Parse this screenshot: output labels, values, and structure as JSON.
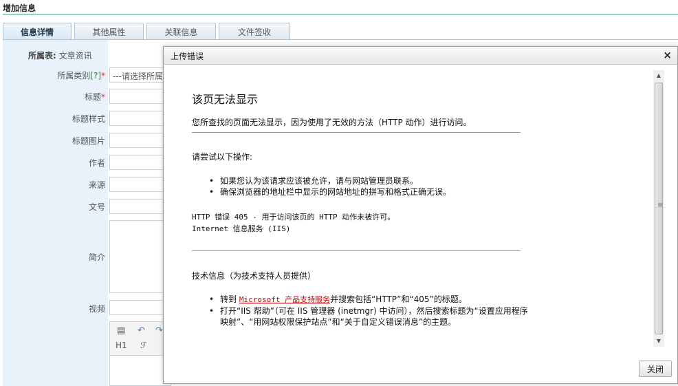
{
  "page": {
    "title": "增加信息"
  },
  "tabs": [
    {
      "label": "信息详情",
      "active": true
    },
    {
      "label": "其他属性",
      "active": false
    },
    {
      "label": "关联信息",
      "active": false
    },
    {
      "label": "文件签收",
      "active": false
    }
  ],
  "form": {
    "owner_label": "所属表:",
    "owner_value": "文章资讯",
    "category_label": "所属类别",
    "category_hint": "[?]",
    "required_mark": "*",
    "category_placeholder": "---请选择所属",
    "fields": {
      "title": "标题",
      "title_style": "标题样式",
      "title_image": "标题图片",
      "author": "作者",
      "source": "来源",
      "doc_no": "文号",
      "summary": "简介",
      "video": "视频"
    },
    "editor_heading_btn": "H1",
    "editor_font_btn": "ℱ"
  },
  "dialog": {
    "title": "上传错误",
    "close_icon": "×",
    "error_title": "该页无法显示",
    "error_desc": "您所查找的页面无法显示，因为使用了无效的方法（HTTP 动作）进行访问。",
    "try_label": "请尝试以下操作:",
    "try_items": [
      "如果您认为该请求应该被允许，请与网站管理员联系。",
      "确保浏览器的地址栏中显示的网站地址的拼写和格式正确无误。"
    ],
    "error_code_line": "HTTP 错误 405 - 用于访问该页的 HTTP 动作未被许可。",
    "server_line": "Internet 信息服务 (IIS)",
    "tech_label": "技术信息（为技术支持人员提供）",
    "tech_item1_prefix": "转到",
    "tech_item1_link": "Microsoft 产品支持服务",
    "tech_item1_suffix": "并搜索包括“HTTP”和“405”的标题。",
    "tech_item2": "打开“IIS 帮助”（可在 IIS 管理器 (inetmgr) 中访问），然后搜索标题为“设置应用程序映射”、“用网站权限保护站点”和“关于自定义错误消息”的主题。",
    "close_button": "关闭"
  },
  "colors": {
    "accent_rule": "#8fd3c6",
    "link": "#cc0000",
    "label_bg": "#e9f2fb"
  }
}
